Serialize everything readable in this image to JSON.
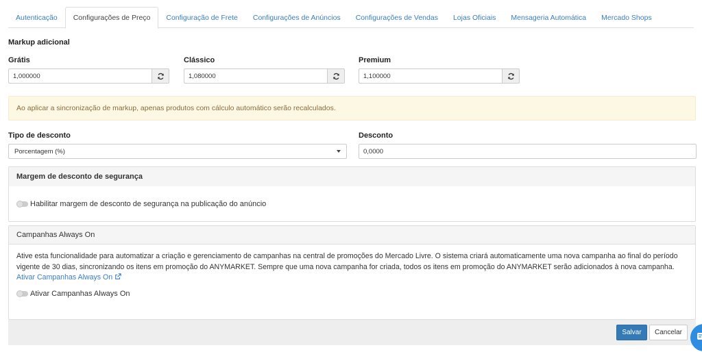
{
  "tabs": [
    {
      "label": "Autenticação",
      "active": false
    },
    {
      "label": "Configurações de Preço",
      "active": true
    },
    {
      "label": "Configuração de Frete",
      "active": false
    },
    {
      "label": "Configurações de Anúncios",
      "active": false
    },
    {
      "label": "Configurações de Vendas",
      "active": false
    },
    {
      "label": "Lojas Oficiais",
      "active": false
    },
    {
      "label": "Mensageria Automática",
      "active": false
    },
    {
      "label": "Mercado Shops",
      "active": false
    }
  ],
  "markup": {
    "title": "Markup adicional",
    "fields": [
      {
        "label": "Grátis",
        "value": "1,000000",
        "icon": "sync-icon"
      },
      {
        "label": "Clássico",
        "value": "1,080000",
        "icon": "sync-icon"
      },
      {
        "label": "Premium",
        "value": "1,100000",
        "icon": "sync-icon"
      }
    ]
  },
  "alert": {
    "text": "Ao aplicar a sincronização de markup, apenas produtos com cálculo automático serão recalculados."
  },
  "discount": {
    "type_label": "Tipo de desconto",
    "type_value": "Porcentagem (%)",
    "value_label": "Desconto",
    "value": "0,0000"
  },
  "safety_margin": {
    "heading": "Margem de desconto de segurança",
    "toggle_label": "Habilitar margem de desconto de segurança na publicação do anúncio",
    "enabled": false
  },
  "campaigns": {
    "heading": "Campanhas Always On",
    "description": "Ative esta funcionalidade para automatizar a criação e gerenciamento de campanhas na central de promoções do Mercado Livre. O sistema criará automaticamente uma nova campanha ao final do período vigente de 30 dias, sincronizando os itens em promoção do ANYMARKET. Sempre que uma nova campanha for criada, todos os itens em promoção do ANYMARKET serão adicionados à nova campanha.",
    "link_text": "Ativar Campanhas Always On",
    "toggle_label": "Ativar Campanhas Always On",
    "enabled": false
  },
  "actions": {
    "save": "Salvar",
    "cancel": "Cancelar"
  },
  "colors": {
    "link": "#3a7ec2",
    "primary": "#337ab7",
    "alert_bg": "#fcf8e3",
    "alert_text": "#8a6d3b"
  }
}
